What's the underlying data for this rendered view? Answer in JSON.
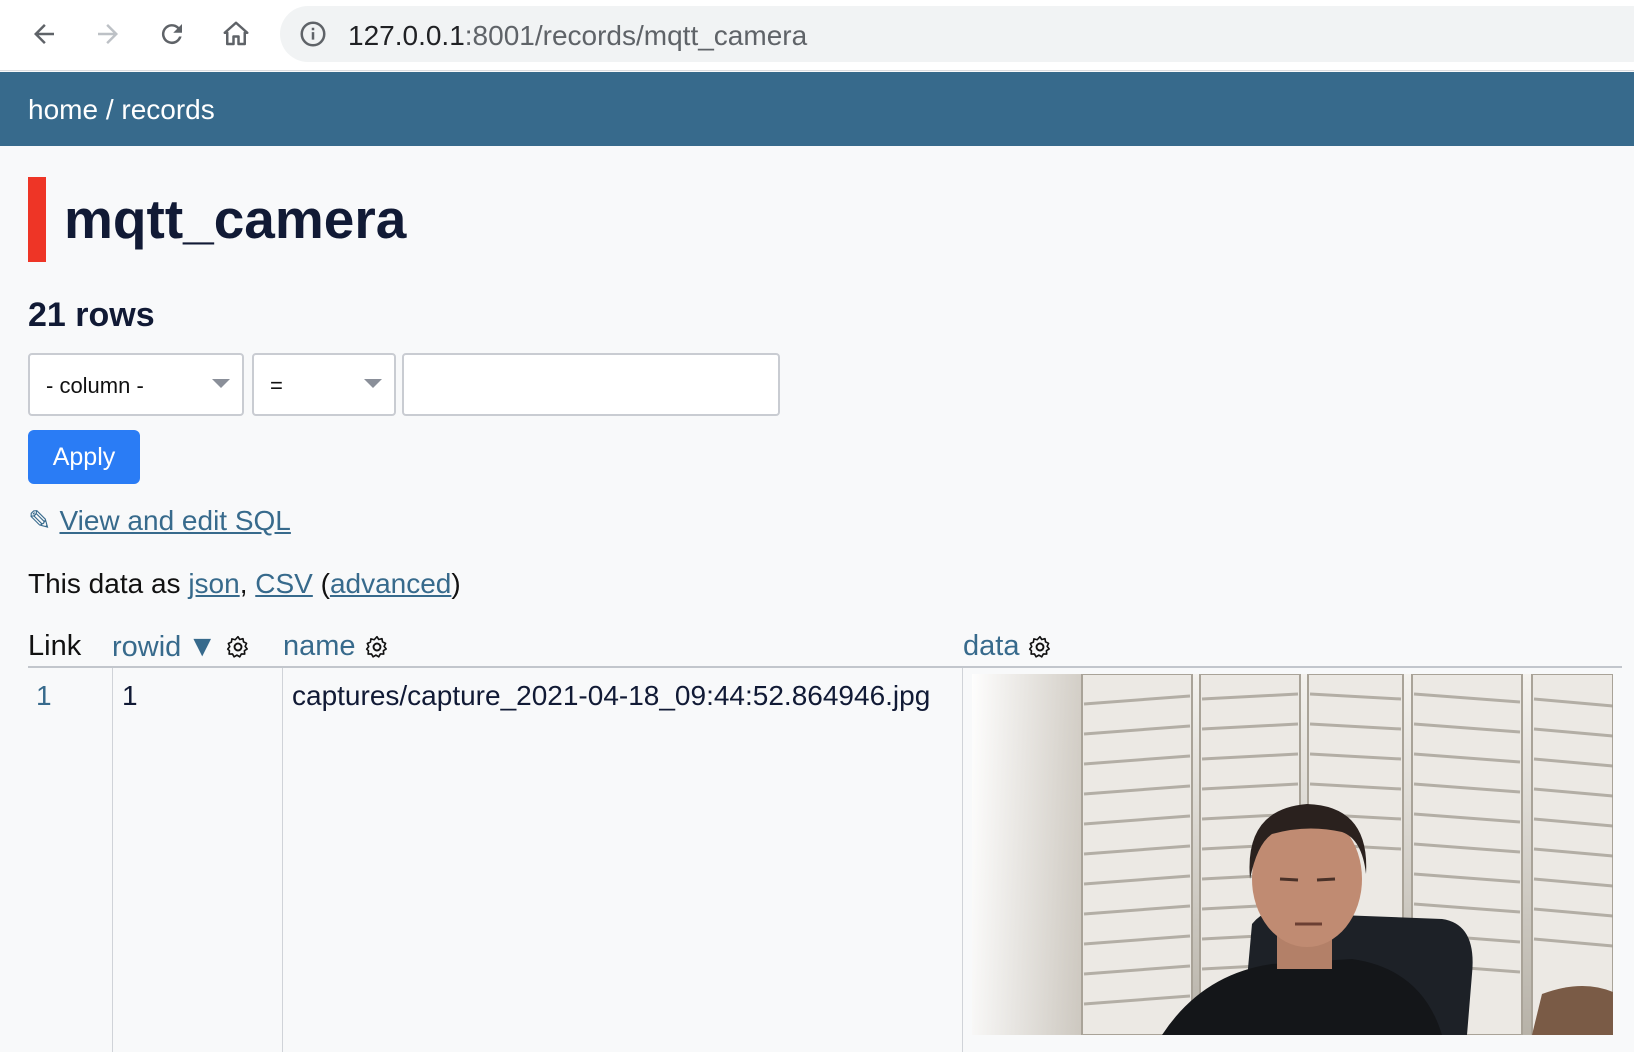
{
  "browser": {
    "url_host": "127.0.0.1",
    "url_path": ":8001/records/mqtt_camera"
  },
  "header": {
    "crumb_home": "home",
    "crumb_sep": " / ",
    "crumb_records": "records"
  },
  "page": {
    "title": "mqtt_camera",
    "row_count": "21 rows"
  },
  "filter": {
    "column_placeholder": "- column -",
    "operator": "=",
    "value": "",
    "apply_label": "Apply"
  },
  "links": {
    "pencil": "✎",
    "view_sql": "View and edit SQL",
    "export_prefix": "This data as ",
    "json": "json",
    "comma": ", ",
    "csv": "CSV",
    "paren_open": " (",
    "advanced": "advanced",
    "paren_close": ")"
  },
  "table": {
    "columns": {
      "link": "Link",
      "rowid": "rowid",
      "rowid_sort": "▼",
      "name": "name",
      "data": "data"
    },
    "rows": [
      {
        "link": "1",
        "rowid": "1",
        "name": "captures/capture_2021-04-18_09:44:52.864946.jpg"
      }
    ]
  },
  "colors": {
    "header_bg": "#376a8c",
    "accent_bar": "#ee3526",
    "apply_button": "#2a7cf5",
    "link": "#376a8c"
  }
}
